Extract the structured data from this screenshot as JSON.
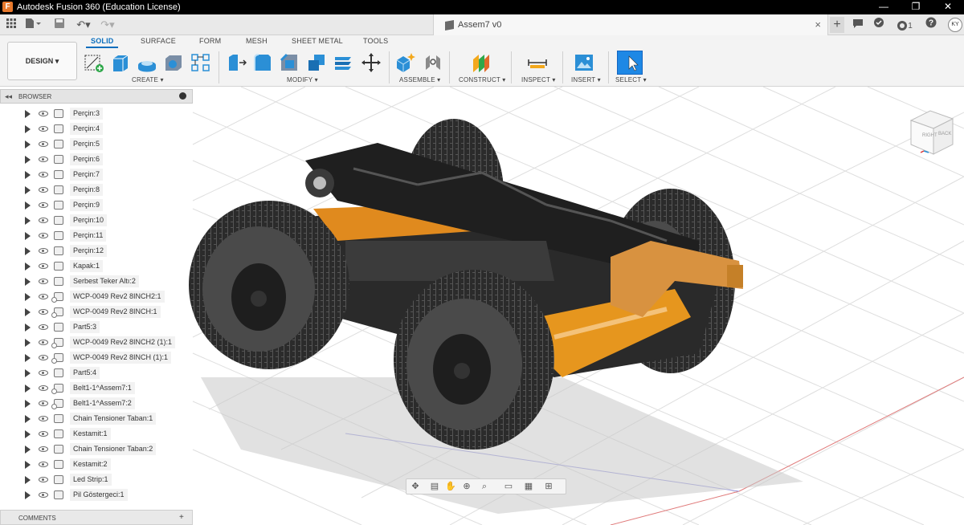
{
  "window": {
    "title": "Autodesk Fusion 360 (Education License)",
    "app_logo_letter": "F",
    "controls": [
      "—",
      "❐",
      "✕"
    ]
  },
  "document": {
    "title": "Assem7 v0",
    "close": "×"
  },
  "quick_access": {
    "user_initials": "KY",
    "notifications_count": "1"
  },
  "ribbon": {
    "workspace": "DESIGN ▾",
    "tabs": [
      {
        "label": "SOLID",
        "active": true
      },
      {
        "label": "SURFACE"
      },
      {
        "label": "FORM"
      },
      {
        "label": "MESH"
      },
      {
        "label": "SHEET METAL"
      },
      {
        "label": "TOOLS"
      }
    ],
    "groups": {
      "create": "CREATE ▾",
      "modify": "MODIFY ▾",
      "assemble": "ASSEMBLE ▾",
      "construct": "CONSTRUCT ▾",
      "inspect": "INSPECT ▾",
      "insert": "INSERT ▾",
      "select": "SELECT ▾"
    }
  },
  "browser": {
    "title": "BROWSER",
    "items": [
      {
        "label": "Perçin:3",
        "linked": false
      },
      {
        "label": "Perçin:4",
        "linked": false
      },
      {
        "label": "Perçin:5",
        "linked": false
      },
      {
        "label": "Perçin:6",
        "linked": false
      },
      {
        "label": "Perçin:7",
        "linked": false
      },
      {
        "label": "Perçin:8",
        "linked": false
      },
      {
        "label": "Perçin:9",
        "linked": false
      },
      {
        "label": "Perçin:10",
        "linked": false
      },
      {
        "label": "Perçin:11",
        "linked": false
      },
      {
        "label": "Perçin:12",
        "linked": false
      },
      {
        "label": "Kapak:1",
        "linked": false
      },
      {
        "label": "Serbest Teker Altı:2",
        "linked": false
      },
      {
        "label": "WCP-0049 Rev2 8INCH2:1",
        "linked": true
      },
      {
        "label": "WCP-0049 Rev2 8INCH:1",
        "linked": true
      },
      {
        "label": "Part5:3",
        "linked": false
      },
      {
        "label": "WCP-0049 Rev2 8INCH2 (1):1",
        "linked": true
      },
      {
        "label": "WCP-0049 Rev2 8INCH (1):1",
        "linked": true
      },
      {
        "label": "Part5:4",
        "linked": false
      },
      {
        "label": "Belt1-1^Assem7:1",
        "linked": true
      },
      {
        "label": "Belt1-1^Assem7:2",
        "linked": true
      },
      {
        "label": "Chain Tensioner Taban:1",
        "linked": false
      },
      {
        "label": "Kestamit:1",
        "linked": false
      },
      {
        "label": "Chain Tensioner Taban:2",
        "linked": false
      },
      {
        "label": "Kestamit:2",
        "linked": false
      },
      {
        "label": "Led Strip:1",
        "linked": false
      },
      {
        "label": "Pil Göstergeci:1",
        "linked": false
      }
    ]
  },
  "comments": {
    "title": "COMMENTS",
    "add": "+"
  },
  "viewcube": {
    "faces": [
      "RIGHT",
      "BACK"
    ]
  },
  "colors": {
    "accent": "#0a6ebd",
    "chassis_orange": "#e08a1e",
    "tire": "#2a2a2a",
    "titlebar": "#000000"
  }
}
